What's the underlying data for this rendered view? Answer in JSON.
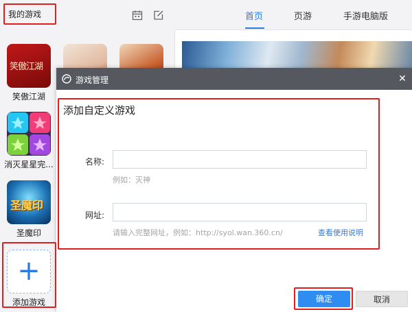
{
  "sidebar": {
    "title": "我的游戏",
    "games": [
      {
        "name": "笑傲江湖",
        "tile_text": "笑傲江湖"
      },
      {
        "name": "消灭星星完..."
      },
      {
        "name": "圣魔印",
        "tile_text": "圣魔印"
      }
    ],
    "add_label": "添加游戏",
    "add_symbol": "+"
  },
  "nav": {
    "tabs": [
      "首页",
      "页游",
      "手游电脑版"
    ],
    "active_tab": "首页"
  },
  "modal": {
    "title": "游戏管理",
    "close_symbol": "✕",
    "section_title": "添加自定义游戏",
    "name_label": "名称:",
    "name_hint": "例如：灭神",
    "url_label": "网址:",
    "url_hint": "请输入完整网址，例如：http://syol.wan.360.cn/",
    "help_link": "查看使用说明",
    "ok_label": "确定",
    "cancel_label": "取消"
  },
  "colors": {
    "accent": "#2a7be6",
    "highlight": "#e01e1e",
    "modal_header": "#55595f"
  }
}
